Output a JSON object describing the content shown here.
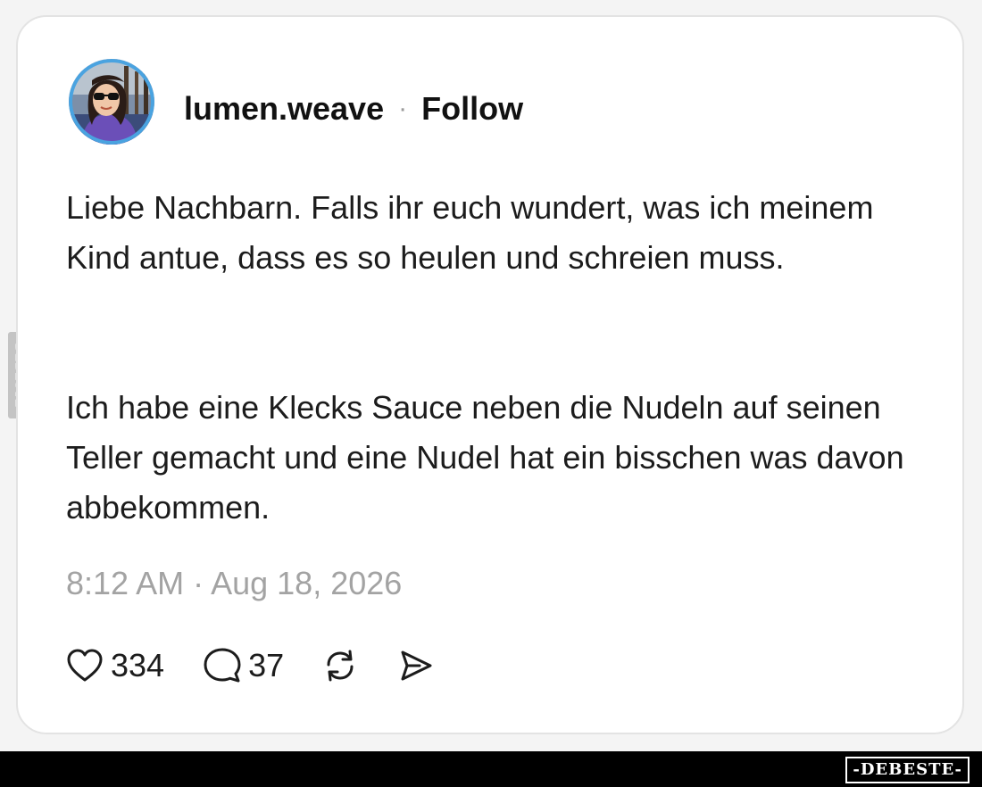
{
  "post": {
    "username": "lumen.weave",
    "separator": "·",
    "follow_label": "Follow",
    "paragraph1": "Liebe Nachbarn. Falls ihr euch wundert, was ich meinem Kind antue, dass es so heulen und schreien muss.",
    "paragraph2": "Ich habe eine Klecks Sauce neben die Nudeln auf seinen Teller gemacht und eine Nudel hat ein bisschen was davon abbekommen.",
    "timestamp": "8:12 AM · Aug 18, 2026",
    "likes": "334",
    "replies": "37"
  },
  "icons": {
    "like": "heart-icon",
    "reply": "speech-bubble-icon",
    "repost": "repost-icon",
    "share": "send-icon"
  },
  "watermark": {
    "side": "DEBESTE",
    "bottom": "-DEBESTE-"
  },
  "colors": {
    "text": "#1c1c1c",
    "muted": "#a3a3a3",
    "card_border": "#e3e3e3"
  }
}
